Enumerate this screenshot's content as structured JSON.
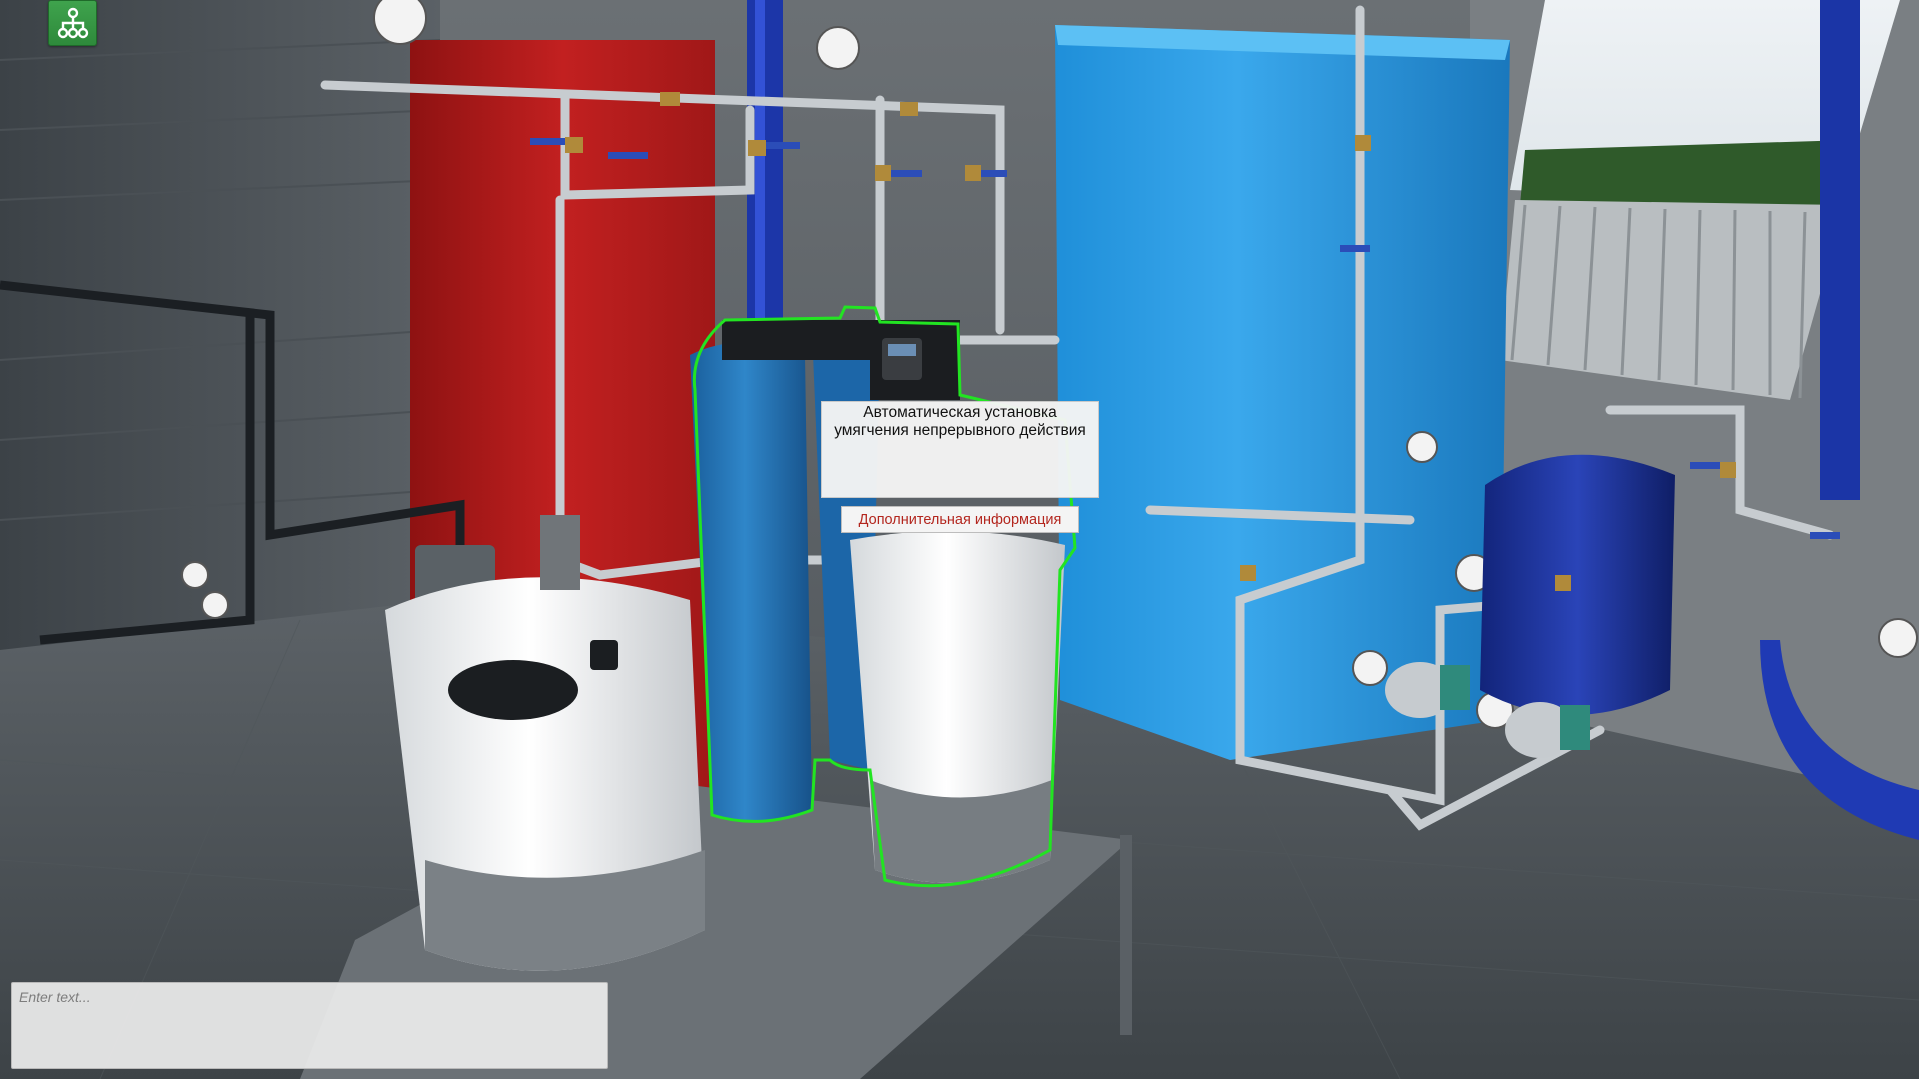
{
  "scene": {
    "description_icon": "3d-viewport",
    "highlight_color": "#22e422"
  },
  "hud": {
    "hierarchy_icon": "hierarchy-icon"
  },
  "tooltip": {
    "title": "Автоматическая установка умягчения непрерывного действия",
    "info_button_label": "Дополнительная информация"
  },
  "chat": {
    "placeholder": "Enter text..."
  }
}
